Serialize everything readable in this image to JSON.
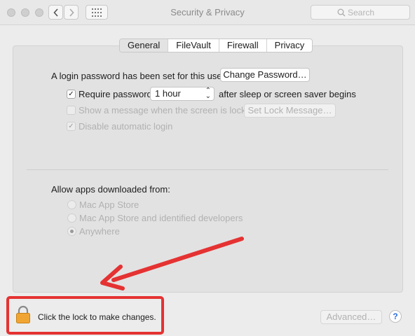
{
  "window": {
    "title": "Security & Privacy",
    "search_placeholder": "Search"
  },
  "tabs": [
    "General",
    "FileVault",
    "Firewall",
    "Privacy"
  ],
  "active_tab": "General",
  "general": {
    "login_text": "A login password has been set for this user",
    "change_password_label": "Change Password…",
    "require_password_label": "Require password",
    "require_password_checked": true,
    "require_password_interval": "1 hour",
    "after_sleep_text": "after sleep or screen saver begins",
    "show_message_label": "Show a message when the screen is locked",
    "show_message_checked": false,
    "set_lock_message_label": "Set Lock Message…",
    "disable_auto_login_label": "Disable automatic login",
    "disable_auto_login_checked": true,
    "allow_apps_label": "Allow apps downloaded from:",
    "allow_apps_options": [
      "Mac App Store",
      "Mac App Store and identified developers",
      "Anywhere"
    ],
    "allow_apps_selected": "Anywhere"
  },
  "footer": {
    "lock_text": "Click the lock to make changes.",
    "advanced_label": "Advanced…",
    "help_label": "?"
  },
  "annotation": {
    "color": "#e53232"
  }
}
